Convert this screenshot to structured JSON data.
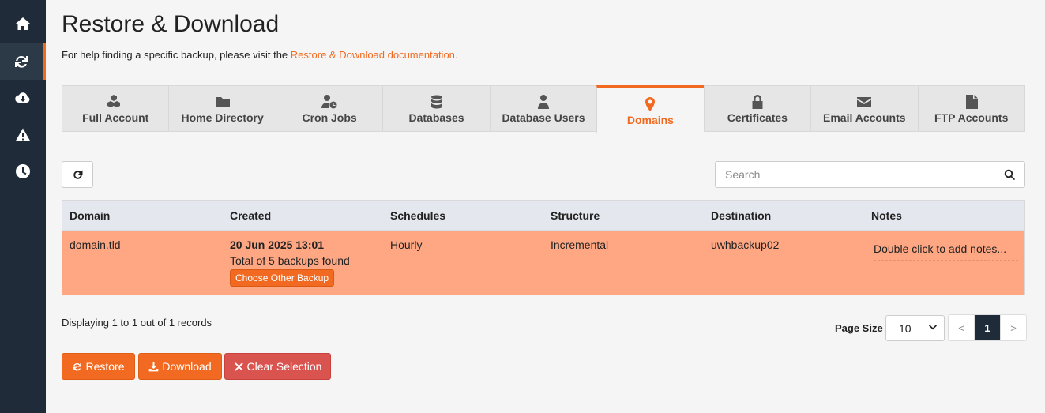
{
  "sidebar": {
    "items": [
      {
        "icon": "home-icon"
      },
      {
        "icon": "sync-icon",
        "active": true
      },
      {
        "icon": "cloud-download-icon"
      },
      {
        "icon": "warning-icon"
      },
      {
        "icon": "clock-icon"
      }
    ]
  },
  "page": {
    "title": "Restore & Download",
    "help_prefix": "For help finding a specific backup, please visit the ",
    "help_link": "Restore & Download documentation."
  },
  "tabs": [
    {
      "label": "Full Account",
      "icon": "cubes-icon"
    },
    {
      "label": "Home Directory",
      "icon": "folder-icon"
    },
    {
      "label": "Cron Jobs",
      "icon": "user-clock-icon"
    },
    {
      "label": "Databases",
      "icon": "database-icon"
    },
    {
      "label": "Database Users",
      "icon": "user-tie-icon"
    },
    {
      "label": "Domains",
      "icon": "map-marker-icon",
      "active": true
    },
    {
      "label": "Certificates",
      "icon": "lock-icon"
    },
    {
      "label": "Email Accounts",
      "icon": "envelope-icon"
    },
    {
      "label": "FTP Accounts",
      "icon": "file-icon"
    }
  ],
  "search": {
    "placeholder": "Search"
  },
  "table": {
    "headers": [
      "Domain",
      "Created",
      "Schedules",
      "Structure",
      "Destination",
      "Notes"
    ],
    "rows": [
      {
        "domain": "domain.tld",
        "created_date": "20 Jun 2025 13:01",
        "created_total": "Total of 5 backups found",
        "choose_label": "Choose Other Backup",
        "schedule": "Hourly",
        "structure": "Incremental",
        "destination": "uwhbackup02",
        "notes": "Double click to add notes..."
      }
    ]
  },
  "records_text": "Displaying 1 to 1 out of 1 records",
  "pagination": {
    "page_size_label": "Page Size",
    "page_size_value": "10",
    "prev": "<",
    "current": "1",
    "next": ">"
  },
  "actions": {
    "restore": "Restore",
    "download": "Download",
    "clear": "Clear Selection"
  },
  "colors": {
    "accent": "#f26a21",
    "sidebar": "#1f2b38",
    "selected_row": "#ffa783",
    "danger": "#d9534f"
  }
}
